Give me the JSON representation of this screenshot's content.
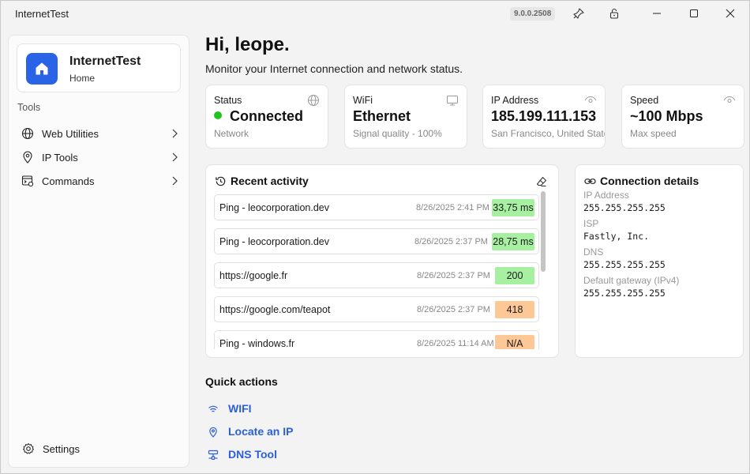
{
  "window": {
    "title": "InternetTest",
    "version": "9.0.0.2508"
  },
  "sidebar": {
    "app_name": "InternetTest",
    "app_page": "Home",
    "tools_label": "Tools",
    "items": [
      {
        "label": "Web Utilities"
      },
      {
        "label": "IP Tools"
      },
      {
        "label": "Commands"
      }
    ],
    "settings_label": "Settings"
  },
  "header": {
    "greeting": "Hi, leope.",
    "subtitle": "Monitor your Internet connection and network status."
  },
  "stats": {
    "status": {
      "label": "Status",
      "value": "Connected",
      "sub": "Network"
    },
    "wifi": {
      "label": "WiFi",
      "value": "Ethernet",
      "sub": "Signal quality - 100%"
    },
    "ip": {
      "label": "IP Address",
      "value": "185.199.111.153",
      "sub": "San Francisco, United States"
    },
    "speed": {
      "label": "Speed",
      "value": "~100 Mbps",
      "sub": "Max speed"
    }
  },
  "recent_activity": {
    "title": "Recent activity",
    "rows": [
      {
        "name": "Ping - leocorporation.dev",
        "time": "8/26/2025 2:41 PM",
        "badge": "33,75 ms",
        "tone": "green"
      },
      {
        "name": "Ping - leocorporation.dev",
        "time": "8/26/2025 2:37 PM",
        "badge": "28,75 ms",
        "tone": "green"
      },
      {
        "name": "https://google.fr",
        "time": "8/26/2025 2:37 PM",
        "badge": "200",
        "tone": "green"
      },
      {
        "name": "https://google.com/teapot",
        "time": "8/26/2025 2:37 PM",
        "badge": "418",
        "tone": "orange"
      },
      {
        "name": "Ping - windows.fr",
        "time": "8/26/2025 11:14 AM",
        "badge": "N/A",
        "tone": "orange"
      }
    ]
  },
  "connection_details": {
    "title": "Connection details",
    "fields": [
      {
        "label": "IP Address",
        "value": "255.255.255.255"
      },
      {
        "label": "ISP",
        "value": "Fastly, Inc."
      },
      {
        "label": "DNS",
        "value": "255.255.255.255"
      },
      {
        "label": "Default gateway (IPv4)",
        "value": "255.255.255.255"
      }
    ]
  },
  "quick_actions": {
    "title": "Quick actions",
    "items": [
      {
        "label": "WIFI",
        "icon": "wifi-icon"
      },
      {
        "label": "Locate an IP",
        "icon": "location-pin-icon"
      },
      {
        "label": "DNS Tool",
        "icon": "dns-server-icon"
      }
    ]
  },
  "colors": {
    "accent": "#2b5fd9",
    "logo_bg": "#2a63e6",
    "status_green": "#1fc41f",
    "badge_green": "#a7f0a2",
    "badge_orange": "#fdc796"
  }
}
